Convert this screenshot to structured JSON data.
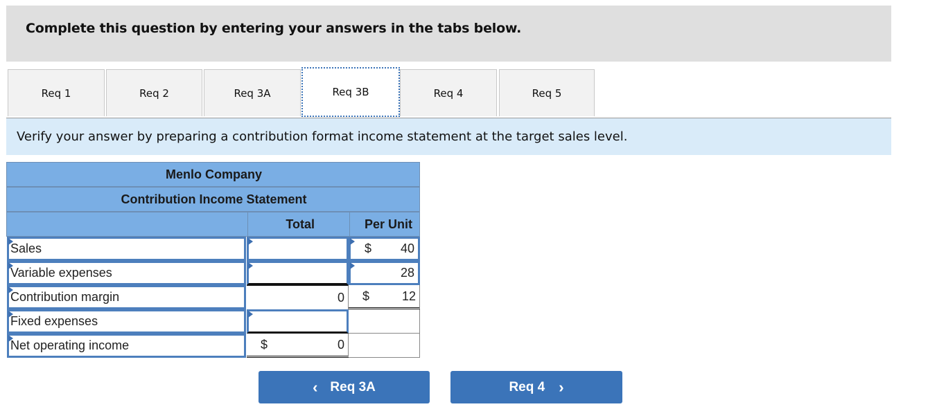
{
  "header": {
    "instruction": "Complete this question by entering your answers in the tabs below."
  },
  "tabs": [
    {
      "label": "Req 1",
      "active": false
    },
    {
      "label": "Req 2",
      "active": false
    },
    {
      "label": "Req 3A",
      "active": false
    },
    {
      "label": "Req 3B",
      "active": true
    },
    {
      "label": "Req 4",
      "active": false
    },
    {
      "label": "Req 5",
      "active": false
    }
  ],
  "prompt": "Verify your answer by preparing a contribution format income statement at the target sales level.",
  "statement": {
    "company": "Menlo Company",
    "title": "Contribution Income Statement",
    "col_total": "Total",
    "col_per_unit": "Per Unit",
    "rows": [
      {
        "label": "Sales",
        "total": "",
        "total_dollar": "",
        "unit_dollar": "$",
        "unit": "40"
      },
      {
        "label": "Variable expenses",
        "total": "",
        "total_dollar": "",
        "unit_dollar": "",
        "unit": "28"
      },
      {
        "label": "Contribution margin",
        "total": "0",
        "total_dollar": "",
        "unit_dollar": "$",
        "unit": "12"
      },
      {
        "label": "Fixed expenses",
        "total": "",
        "total_dollar": "",
        "unit_dollar": "",
        "unit": ""
      },
      {
        "label": "Net operating income",
        "total": "0",
        "total_dollar": "$",
        "unit_dollar": "",
        "unit": ""
      }
    ]
  },
  "nav": {
    "prev_label": "Req 3A",
    "next_label": "Req 4",
    "prev_icon": "chevron-left-icon",
    "next_icon": "chevron-right-icon"
  }
}
